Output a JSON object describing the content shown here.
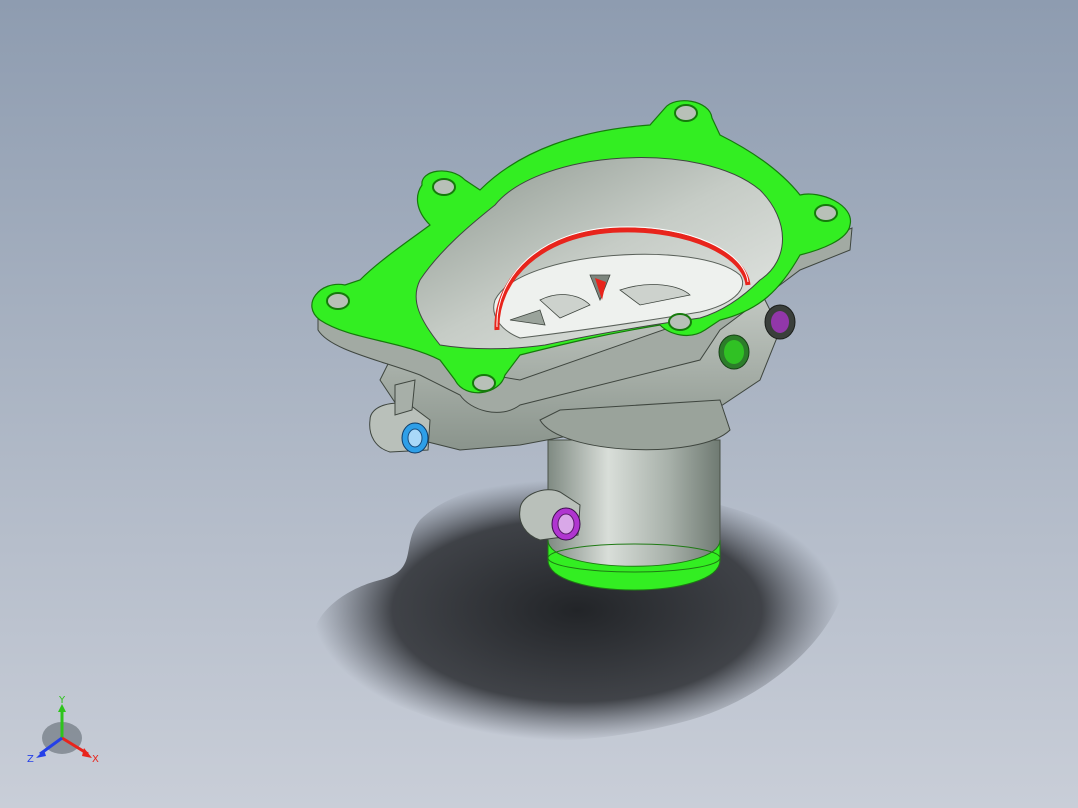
{
  "viewport": {
    "background_top": "#8e9cb0",
    "background_bottom": "#c9ced8"
  },
  "model": {
    "body_color": "#b4bcb5",
    "body_dark": "#7d877f",
    "highlight_face_color": "#33ee22",
    "seal_ring_color": "#e8241c",
    "port_blue_color": "#2e9fe8",
    "port_purple_color": "#b035d0"
  },
  "triad": {
    "x_label": "X",
    "y_label": "Y",
    "z_label": "Z",
    "x_color": "#e8241c",
    "y_color": "#2ec41c",
    "z_color": "#2540e8"
  }
}
